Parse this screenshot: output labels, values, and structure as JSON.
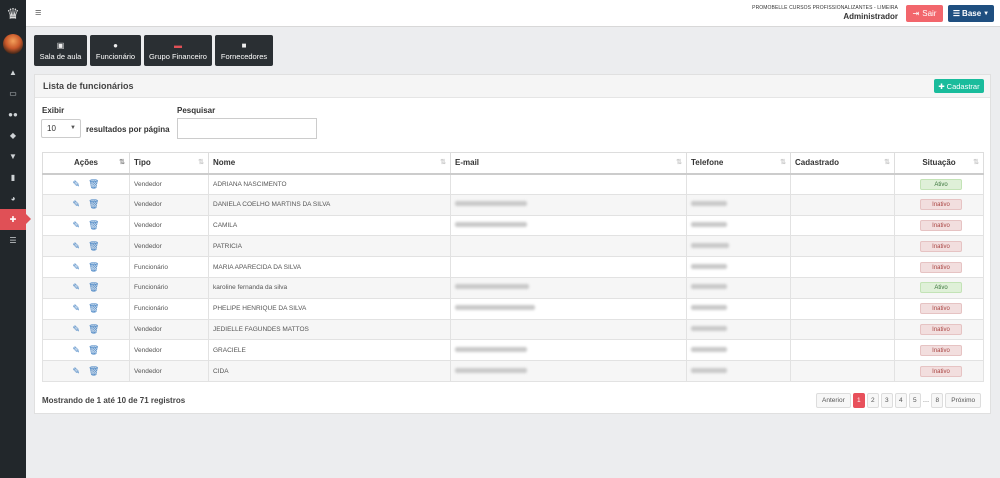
{
  "topbar": {
    "company": "PROMOBELLE CURSOS PROFISSIONALIZANTES - LIMEIRA",
    "role": "Administrador",
    "logout_label": "Sair",
    "base_label": "Base"
  },
  "sidebar": {
    "items": [
      {
        "icon": "chart-icon"
      },
      {
        "icon": "laptop-icon"
      },
      {
        "icon": "users-icon"
      },
      {
        "icon": "cube-icon"
      },
      {
        "icon": "graduation-cap-icon"
      },
      {
        "icon": "id-badge-icon"
      },
      {
        "icon": "pie-chart-icon"
      },
      {
        "icon": "plus-circle-icon",
        "active": true
      },
      {
        "icon": "list-icon"
      }
    ]
  },
  "quick_buttons": [
    {
      "label": "Sala de aula",
      "icon": "book-icon"
    },
    {
      "label": "Funcionário",
      "icon": "user-icon"
    },
    {
      "label": "Grupo Financeiro",
      "icon": "flag-icon"
    },
    {
      "label": "Fornecedores",
      "icon": "truck-icon"
    }
  ],
  "panel": {
    "title": "Lista de funcionários",
    "add_label": "Cadastrar"
  },
  "controls": {
    "show_label": "Exibir",
    "page_size": "10",
    "per_page_label": "resultados por página",
    "search_label": "Pesquisar",
    "search_value": ""
  },
  "table": {
    "columns": [
      "Ações",
      "Tipo",
      "Nome",
      "E-mail",
      "Telefone",
      "Cadastrado",
      "Situação"
    ],
    "rows": [
      {
        "tipo": "Vendedor",
        "nome": "ADRIANA NASCIMENTO",
        "email": "",
        "telefone": "",
        "cadastrado": "",
        "situacao": "Ativo"
      },
      {
        "tipo": "Vendedor",
        "nome": "DANIELA COELHO MARTINS DA SILVA",
        "email": "",
        "telefone": "",
        "cadastrado": "",
        "situacao": "Inativo"
      },
      {
        "tipo": "Vendedor",
        "nome": "CAMILA",
        "email": "",
        "telefone": "",
        "cadastrado": "",
        "situacao": "Inativo"
      },
      {
        "tipo": "Vendedor",
        "nome": "PATRICIA",
        "email": "",
        "telefone": "",
        "cadastrado": "",
        "situacao": "Inativo"
      },
      {
        "tipo": "Funcionário",
        "nome": "MARIA APARECIDA DA SILVA",
        "email": "",
        "telefone": "",
        "cadastrado": "",
        "situacao": "Inativo"
      },
      {
        "tipo": "Funcionário",
        "nome": "karoline fernanda da silva",
        "email": "",
        "telefone": "",
        "cadastrado": "",
        "situacao": "Ativo"
      },
      {
        "tipo": "Funcionário",
        "nome": "PHELIPE HENRIQUE DA SILVA",
        "email": "",
        "telefone": "",
        "cadastrado": "",
        "situacao": "Inativo"
      },
      {
        "tipo": "Vendedor",
        "nome": "JEDIELLE FAGUNDES MATTOS",
        "email": "",
        "telefone": "",
        "cadastrado": "",
        "situacao": "Inativo"
      },
      {
        "tipo": "Vendedor",
        "nome": "GRACIELE",
        "email": "",
        "telefone": "",
        "cadastrado": "",
        "situacao": "Inativo"
      },
      {
        "tipo": "Vendedor",
        "nome": "CIDA",
        "email": "",
        "telefone": "",
        "cadastrado": "",
        "situacao": "Inativo"
      }
    ]
  },
  "footer": {
    "info": "Mostrando de 1 até 10 de 71 registros",
    "prev_label": "Anterior",
    "next_label": "Próximo",
    "pages": [
      "1",
      "2",
      "3",
      "4",
      "5",
      "…",
      "8"
    ],
    "current_page": "1"
  },
  "colors": {
    "sidebar": "#22272b",
    "accent_red": "#e8505b",
    "brand_blue": "#1f4f80",
    "add_green": "#1abc9c",
    "icon_blue": "#3a7bbf"
  }
}
